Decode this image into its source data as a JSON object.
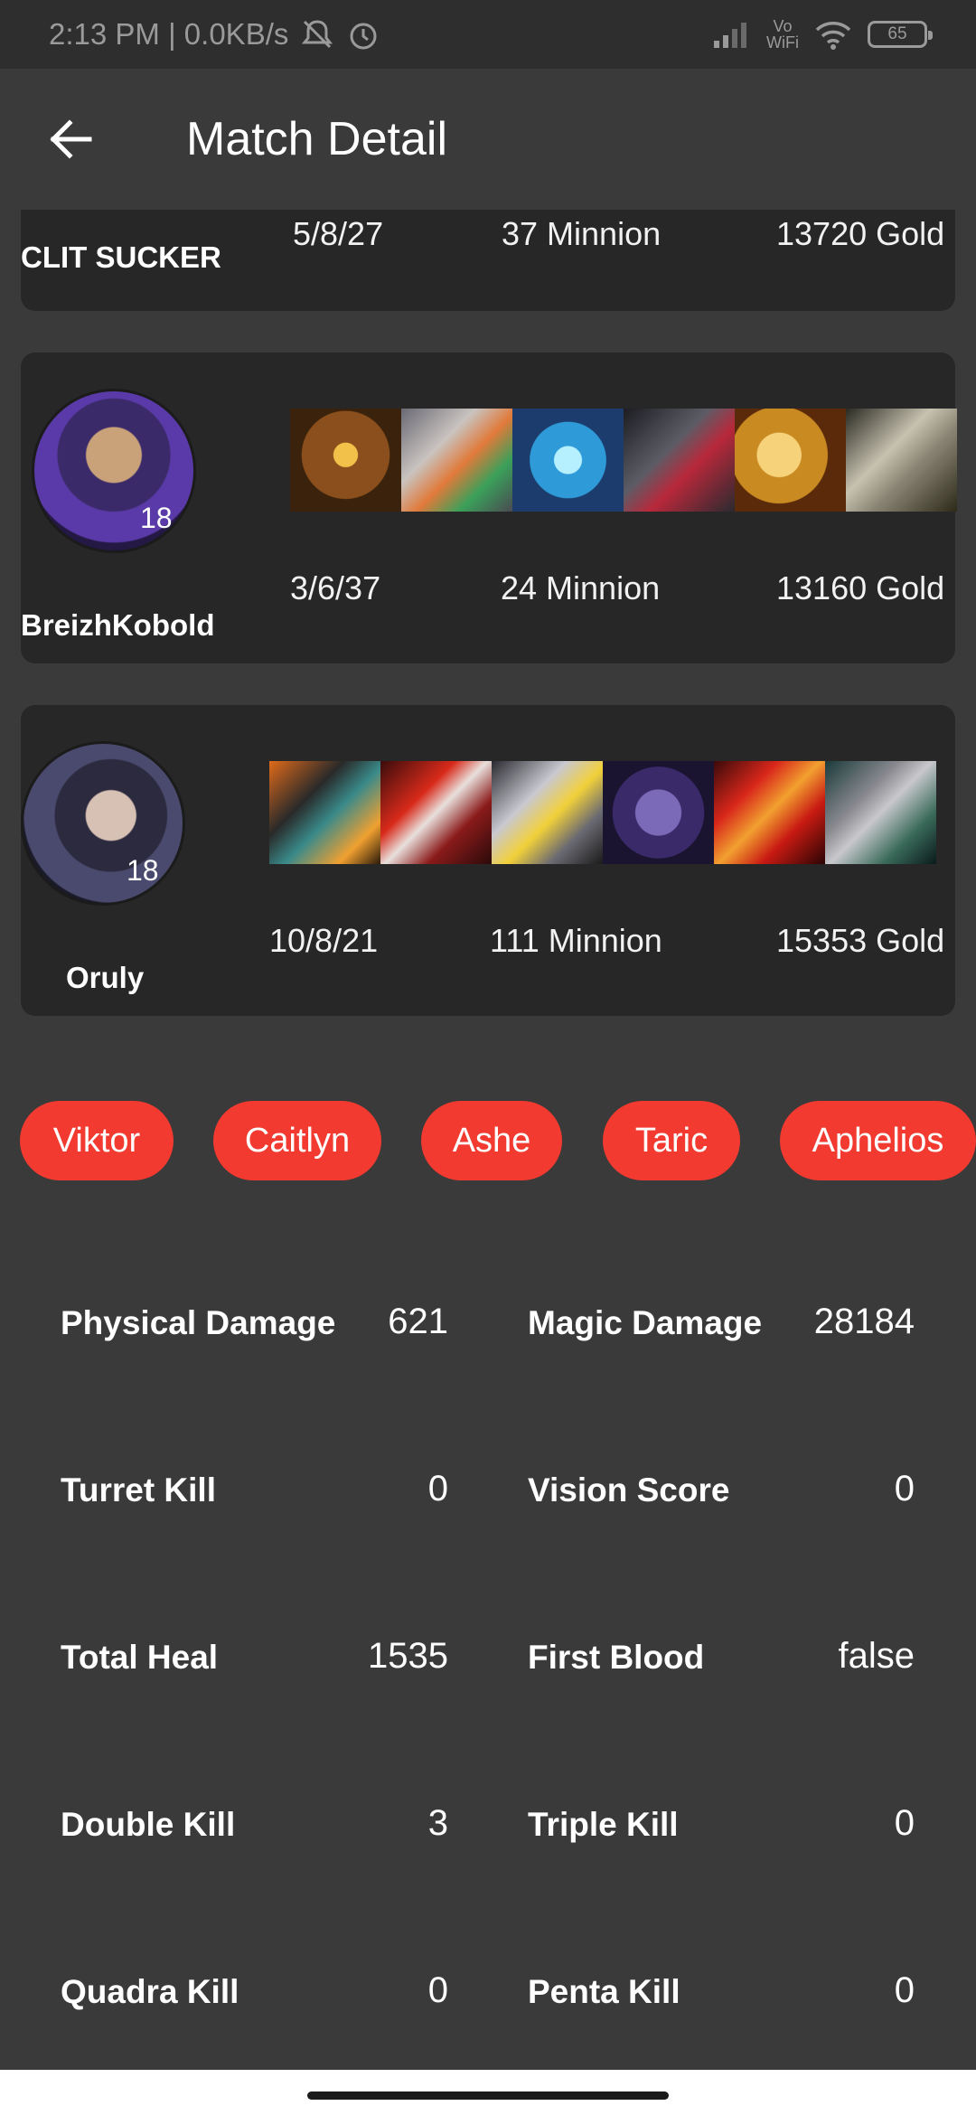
{
  "status_bar": {
    "time_speed": "2:13 PM | 0.0KB/s",
    "vowifi_line1": "Vo",
    "vowifi_line2": "WiFi",
    "battery": "65"
  },
  "header": {
    "title": "Match Detail"
  },
  "players": [
    {
      "name": "CLIT SUCKER",
      "kda": "5/8/27",
      "minions": "37 Minnion",
      "gold": "13720 Gold"
    },
    {
      "name": "BreizhKobold",
      "level": "18",
      "kda": "3/6/37",
      "minions": "24 Minnion",
      "gold": "13160 Gold"
    },
    {
      "name": "Oruly",
      "level": "18",
      "kda": "10/8/21",
      "minions": "111 Minnion",
      "gold": "15353 Gold"
    }
  ],
  "champions": [
    "Viktor",
    "Caitlyn",
    "Ashe",
    "Taric",
    "Aphelios"
  ],
  "stats": {
    "physical_damage": {
      "label": "Physical Damage",
      "value": "621"
    },
    "magic_damage": {
      "label": "Magic Damage",
      "value": "28184"
    },
    "turret_kill": {
      "label": "Turret Kill",
      "value": "0"
    },
    "vision_score": {
      "label": "Vision Score",
      "value": "0"
    },
    "total_heal": {
      "label": "Total Heal",
      "value": "1535"
    },
    "first_blood": {
      "label": "First Blood",
      "value": "false"
    },
    "double_kill": {
      "label": "Double Kill",
      "value": "3"
    },
    "triple_kill": {
      "label": "Triple Kill",
      "value": "0"
    },
    "quadra_kill": {
      "label": "Quadra Kill",
      "value": "0"
    },
    "penta_kill": {
      "label": "Penta Kill",
      "value": "0"
    }
  },
  "colors": {
    "background": "#3a3a3a",
    "card": "#272727",
    "chip": "#f23a30"
  }
}
